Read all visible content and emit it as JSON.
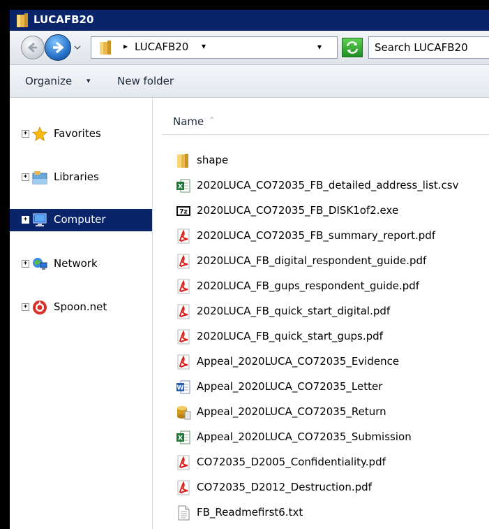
{
  "window": {
    "title": "LUCAFB20",
    "colors": {
      "titlebar": "#0a246a",
      "selection": "#0a246a"
    }
  },
  "address": {
    "crumb": "LUCAFB20",
    "separator": "▸",
    "dropdown": "▾",
    "search_placeholder": "Search LUCAFB20"
  },
  "toolbar": {
    "organize_label": "Organize",
    "organize_caret": "▾",
    "new_folder_label": "New folder"
  },
  "nav": {
    "items": [
      {
        "label": "Favorites",
        "icon": "star-icon",
        "expander": "+"
      },
      {
        "label": "Libraries",
        "icon": "library-icon",
        "expander": "+"
      },
      {
        "label": "Computer",
        "icon": "computer-icon",
        "expander": "+",
        "selected": true
      },
      {
        "label": "Network",
        "icon": "network-icon",
        "expander": "+"
      },
      {
        "label": "Spoon.net",
        "icon": "spoon-icon",
        "expander": "+"
      }
    ]
  },
  "list": {
    "column_name": "Name",
    "sort_indicator": "^",
    "files": [
      {
        "name": "shape",
        "icon": "folder-icon"
      },
      {
        "name": "2020LUCA_CO72035_FB_detailed_address_list.csv",
        "icon": "excel-icon"
      },
      {
        "name": "2020LUCA_CO72035_FB_DISK1of2.exe",
        "icon": "7z-icon"
      },
      {
        "name": "2020LUCA_CO72035_FB_summary_report.pdf",
        "icon": "pdf-icon"
      },
      {
        "name": "2020LUCA_FB_digital_respondent_guide.pdf",
        "icon": "pdf-icon"
      },
      {
        "name": "2020LUCA_FB_gups_respondent_guide.pdf",
        "icon": "pdf-icon"
      },
      {
        "name": "2020LUCA_FB_quick_start_digital.pdf",
        "icon": "pdf-icon"
      },
      {
        "name": "2020LUCA_FB_quick_start_gups.pdf",
        "icon": "pdf-icon"
      },
      {
        "name": "Appeal_2020LUCA_CO72035_Evidence",
        "icon": "pdf-icon"
      },
      {
        "name": "Appeal_2020LUCA_CO72035_Letter",
        "icon": "word-icon"
      },
      {
        "name": "Appeal_2020LUCA_CO72035_Return",
        "icon": "database-icon"
      },
      {
        "name": "Appeal_2020LUCA_CO72035_Submission",
        "icon": "excel-icon"
      },
      {
        "name": "CO72035_D2005_Confidentiality.pdf",
        "icon": "pdf-icon"
      },
      {
        "name": "CO72035_D2012_Destruction.pdf",
        "icon": "pdf-icon"
      },
      {
        "name": "FB_Readmefirst6.txt",
        "icon": "text-file-icon"
      }
    ]
  }
}
